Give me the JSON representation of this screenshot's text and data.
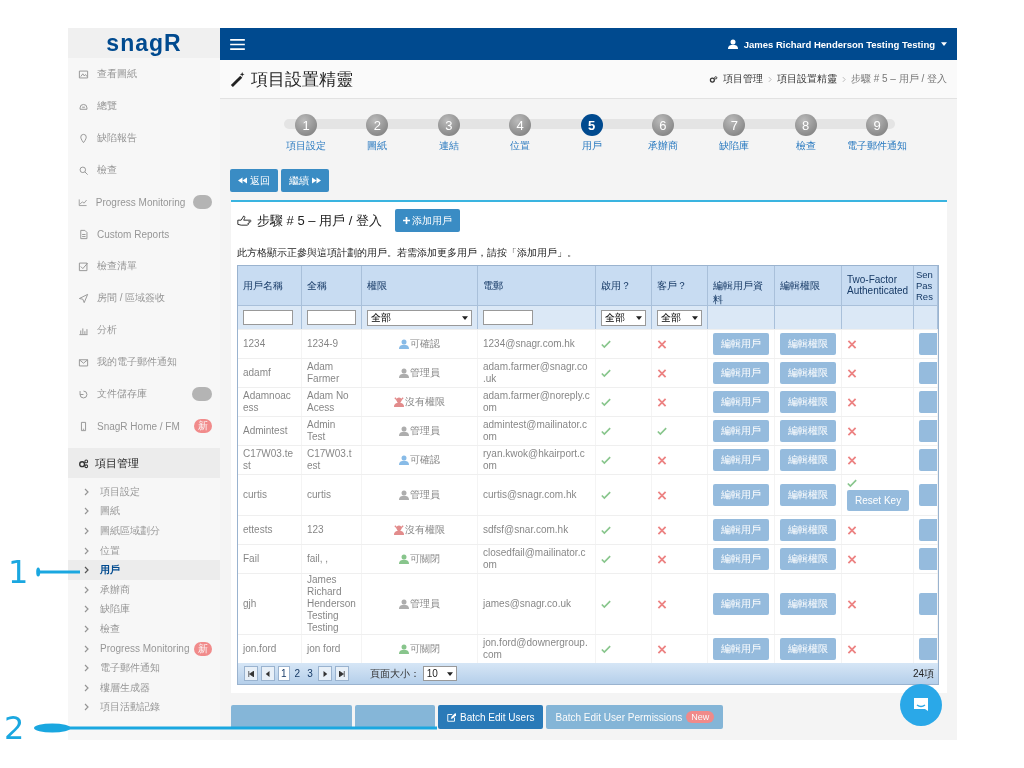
{
  "callouts": [
    {
      "number": "1"
    },
    {
      "number": "2"
    }
  ],
  "sidebar": {
    "logo": "snagR",
    "items": [
      {
        "label": "查看圖紙",
        "dimmed": true
      },
      {
        "label": "總覽",
        "dimmed": true
      },
      {
        "label": "缺陷報告",
        "dimmed": true
      },
      {
        "label": "檢查",
        "dimmed": true
      },
      {
        "label": "Progress Monitoring",
        "dimmed": true,
        "badge": {
          "kind": "blank"
        }
      },
      {
        "label": "Custom Reports",
        "dimmed": true
      },
      {
        "label": "檢查清單",
        "dimmed": true
      },
      {
        "label": "房間 / 區域簽收",
        "dimmed": true
      },
      {
        "label": "分析",
        "dimmed": true
      },
      {
        "label": "我的電子郵件通知",
        "dimmed": true
      },
      {
        "label": "文件儲存庫",
        "dimmed": true,
        "badge": {
          "kind": "blank"
        }
      },
      {
        "label": "SnagR Home / FM",
        "dimmed": true,
        "badge": {
          "kind": "new",
          "text": "新"
        }
      }
    ],
    "section": {
      "label": "項目管理",
      "children": [
        {
          "label": "項目設定",
          "selected": false
        },
        {
          "label": "圖紙",
          "selected": false
        },
        {
          "label": "圖紙區域劃分",
          "selected": false
        },
        {
          "label": "位置",
          "selected": false
        },
        {
          "label": "用戶",
          "selected": true
        },
        {
          "label": "承辦商",
          "selected": false
        },
        {
          "label": "缺陷庫",
          "selected": false
        },
        {
          "label": "檢查",
          "selected": false
        },
        {
          "label": "Progress Monitoring",
          "selected": false,
          "badge": {
            "kind": "new",
            "text": "新"
          }
        },
        {
          "label": "電子郵件通知",
          "selected": false
        },
        {
          "label": "樓層生成器",
          "selected": false
        },
        {
          "label": "項目活動記錄",
          "selected": false
        }
      ]
    }
  },
  "header": {
    "user": "James Richard Henderson Testing Testing"
  },
  "page": {
    "title": "項目設置精靈",
    "breadcrumb": [
      "項目管理",
      "項目設置精靈",
      "步驟 # 5 – 用戶 / 登入"
    ]
  },
  "wizard": {
    "steps": [
      {
        "number": "1",
        "label": "項目設定",
        "selected": false
      },
      {
        "number": "2",
        "label": "圖紙",
        "selected": false
      },
      {
        "number": "3",
        "label": "連結",
        "selected": false
      },
      {
        "number": "4",
        "label": "位置",
        "selected": false
      },
      {
        "number": "5",
        "label": "用戶",
        "selected": true
      },
      {
        "number": "6",
        "label": "承辦商",
        "selected": false
      },
      {
        "number": "7",
        "label": "缺陷庫",
        "selected": false
      },
      {
        "number": "8",
        "label": "檢查",
        "selected": false
      },
      {
        "number": "9",
        "label": "電子郵件通知",
        "selected": false
      }
    ],
    "back": "返回",
    "next": "繼續"
  },
  "panel": {
    "title": "步驟 # 5 – 用戶 / 登入",
    "add_button": "添加用戶",
    "description": "此方格顯示正參與這項計劃的用戶。若需添加更多用戶，請按「添加用戶」。"
  },
  "table": {
    "rows_dimmed": true,
    "columns": [
      "用戶名稱",
      "全稱",
      "權限",
      "電郵",
      "啟用？",
      "客戶？",
      "編輯用戶資料",
      "編輯權限",
      "Two-Factor Authenticated",
      "Sen Pas Res"
    ],
    "filters": [
      {
        "kind": "text"
      },
      {
        "kind": "text"
      },
      {
        "kind": "select",
        "value": "全部"
      },
      {
        "kind": "text"
      },
      {
        "kind": "select",
        "value": "全部"
      },
      {
        "kind": "select",
        "value": "全部"
      }
    ],
    "rows": [
      {
        "username": "1234",
        "full_name": "1234-9",
        "role": {
          "text": "可確認",
          "kind": "confirm"
        },
        "email": "1234@snagr.com.hk",
        "enabled": true,
        "client": false,
        "edit_user": "編輯用戶",
        "edit_permissions": "編輯權限",
        "two_factor": false
      },
      {
        "username": "adamf",
        "full_name": "Adam Farmer",
        "role": {
          "text": "管理員",
          "kind": "admin"
        },
        "email": "adam.farmer@snagr.co.uk",
        "enabled": true,
        "client": false,
        "edit_user": "編輯用戶",
        "edit_permissions": "編輯權限",
        "two_factor": false
      },
      {
        "username": "Adamnoacess",
        "full_name": "Adam No Acess",
        "role": {
          "text": "沒有權限",
          "kind": "none"
        },
        "email": "adam.farmer@noreply.com",
        "enabled": true,
        "client": false,
        "edit_user": "編輯用戶",
        "edit_permissions": "編輯權限",
        "two_factor": false
      },
      {
        "username": "Admintest",
        "full_name": "Admin Test",
        "role": {
          "text": "管理員",
          "kind": "admin"
        },
        "email": "admintest@mailinator.com",
        "enabled": true,
        "client": true,
        "edit_user": "編輯用戶",
        "edit_permissions": "編輯權限",
        "two_factor": false
      },
      {
        "username": "C17W03.test",
        "full_name": "C17W03.test",
        "role": {
          "text": "可確認",
          "kind": "confirm"
        },
        "email": "ryan.kwok@hkairport.com",
        "enabled": true,
        "client": false,
        "edit_user": "編輯用戶",
        "edit_permissions": "編輯權限",
        "two_factor": false
      },
      {
        "username": "curtis",
        "full_name": "curtis",
        "role": {
          "text": "管理員",
          "kind": "admin"
        },
        "email": "curtis@snagr.com.hk",
        "enabled": true,
        "client": false,
        "edit_user": "編輯用戶",
        "edit_permissions": "編輯權限",
        "two_factor": true,
        "reset_key": "Reset Key"
      },
      {
        "username": "ettests",
        "full_name": "123",
        "role": {
          "text": "沒有權限",
          "kind": "none"
        },
        "email": "sdfsf@snar.com.hk",
        "enabled": true,
        "client": false,
        "edit_user": "編輯用戶",
        "edit_permissions": "編輯權限",
        "two_factor": false
      },
      {
        "username": "Fail",
        "full_name": "fail, ,",
        "role": {
          "text": "可關閉",
          "kind": "close"
        },
        "email": "closedfail@mailinator.com",
        "enabled": true,
        "client": false,
        "edit_user": "編輯用戶",
        "edit_permissions": "編輯權限",
        "two_factor": false
      },
      {
        "username": "gjh",
        "full_name": "James Richard Henderson Testing Testing",
        "role": {
          "text": "管理員",
          "kind": "admin"
        },
        "email": "james@snagr.co.uk",
        "enabled": true,
        "client": false,
        "edit_user": "編輯用戶",
        "edit_permissions": "編輯權限",
        "two_factor": false
      },
      {
        "username": "jon.ford",
        "full_name": "jon ford",
        "role": {
          "text": "可關閉",
          "kind": "close"
        },
        "email": "jon.ford@downergroup.com",
        "enabled": true,
        "client": false,
        "edit_user": "編輯用戶",
        "edit_permissions": "編輯權限",
        "two_factor": false
      }
    ],
    "pager": {
      "pages": [
        {
          "label": "1",
          "selected": true
        },
        {
          "label": "2",
          "selected": false
        },
        {
          "label": "3",
          "selected": false
        }
      ],
      "page_size_label": "頁面大小：",
      "page_size": "10",
      "total": "24項"
    }
  },
  "actions": [
    {
      "kind": "blank",
      "dimmed": true
    },
    {
      "kind": "blank",
      "dimmed": true
    },
    {
      "kind": "edit",
      "label": "Batch Edit Users",
      "dimmed": false
    },
    {
      "kind": "text",
      "label": "Batch Edit User Permissions",
      "badge": "New",
      "dimmed": true
    }
  ]
}
